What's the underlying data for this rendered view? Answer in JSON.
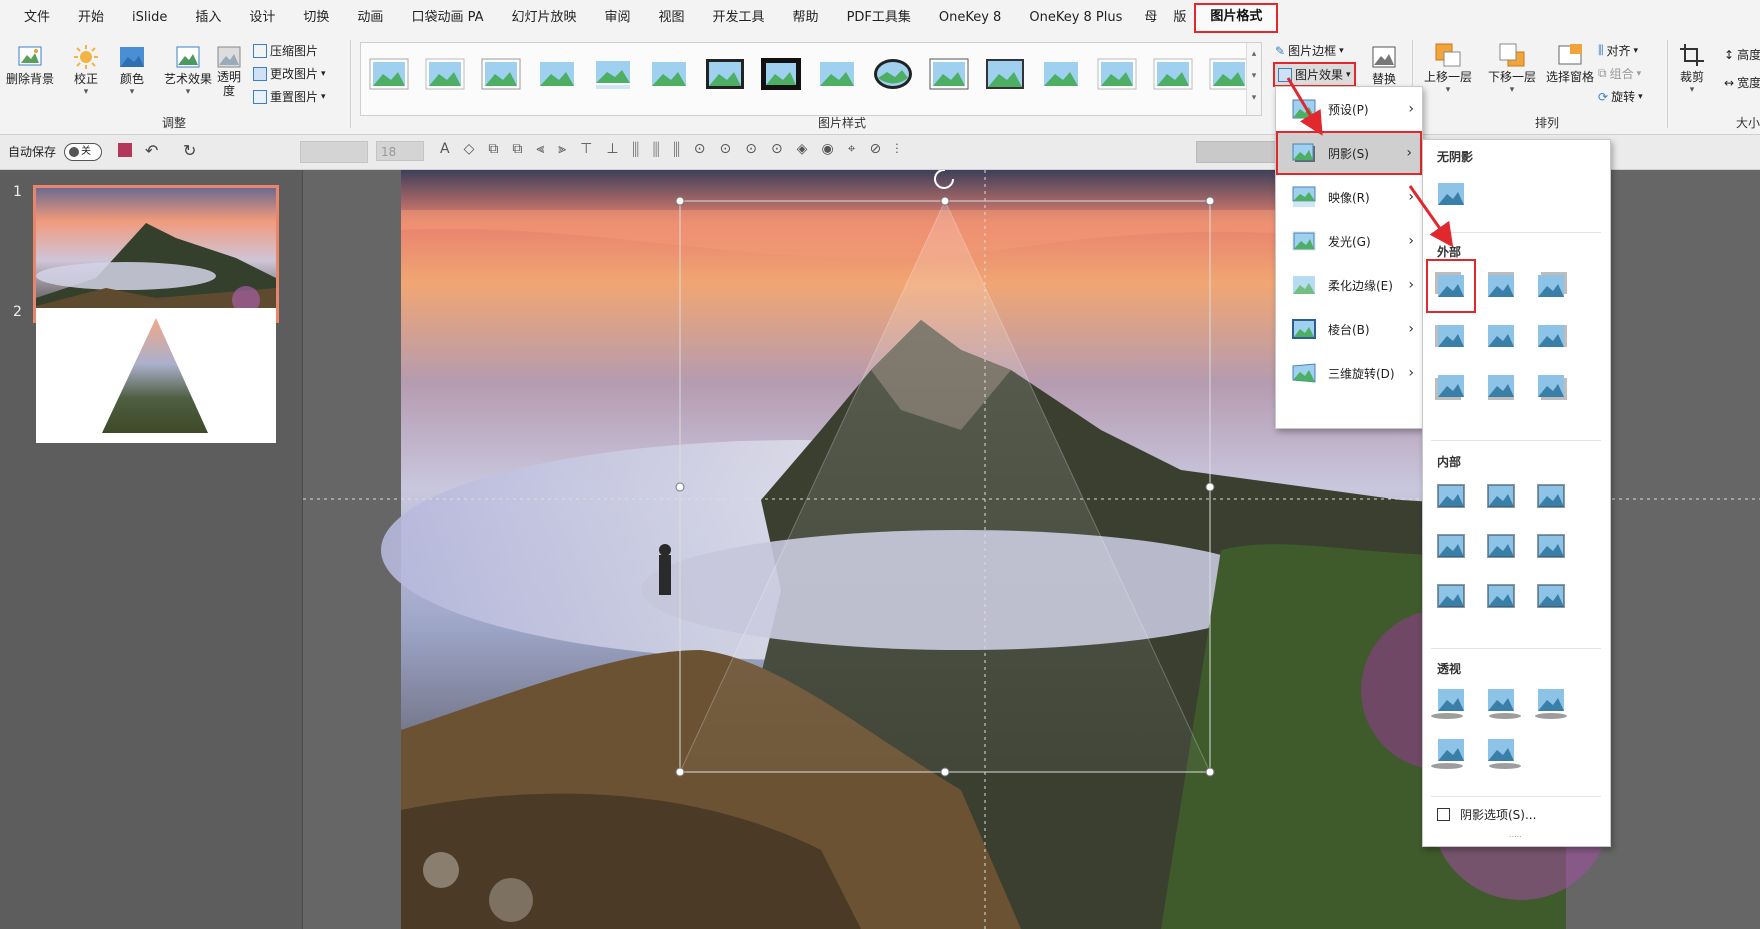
{
  "tabs": [
    "文件",
    "开始",
    "iSlide",
    "插入",
    "设计",
    "切换",
    "动画",
    "口袋动画 PA",
    "幻灯片放映",
    "审阅",
    "视图",
    "开发工具",
    "帮助",
    "PDF工具集",
    "OneKey 8",
    "OneKey 8 Plus",
    "母",
    "版",
    "图片格式"
  ],
  "ribbon": {
    "remove_bg": "删除背景",
    "correct": "校正",
    "color": "颜色",
    "art": "艺术效果",
    "transparency": "透明度",
    "compress": "压缩图片",
    "change": "更改图片",
    "reset": "重置图片",
    "adjust_group": "调整",
    "styles_group": "图片样式",
    "border": "图片边框",
    "effects": "图片效果",
    "replace": "替换",
    "bring_forward": "上移一层",
    "send_backward": "下移一层",
    "selection_pane": "选择窗格",
    "align": "对齐",
    "group": "组合",
    "rotate": "旋转",
    "arrange_group": "排列",
    "crop": "裁剪",
    "height": "高度",
    "width": "宽度",
    "size_group": "大小"
  },
  "toolbar": {
    "autosave": "自动保存",
    "autosave_state": "关",
    "font_size": "18"
  },
  "slides": [
    "1",
    "2"
  ],
  "effects_menu": {
    "items": [
      "预设(P)",
      "阴影(S)",
      "映像(R)",
      "发光(G)",
      "柔化边缘(E)",
      "棱台(B)",
      "三维旋转(D)"
    ]
  },
  "shadow_menu": {
    "no_shadow": "无阴影",
    "outer": "外部",
    "inner": "内部",
    "perspective": "透视",
    "options": "阴影选项(S)..."
  },
  "colors": {
    "accent_red": "#e0282e",
    "ribbon_bg": "#f3f3f3",
    "selected_thumb_border": "#e8866c"
  }
}
